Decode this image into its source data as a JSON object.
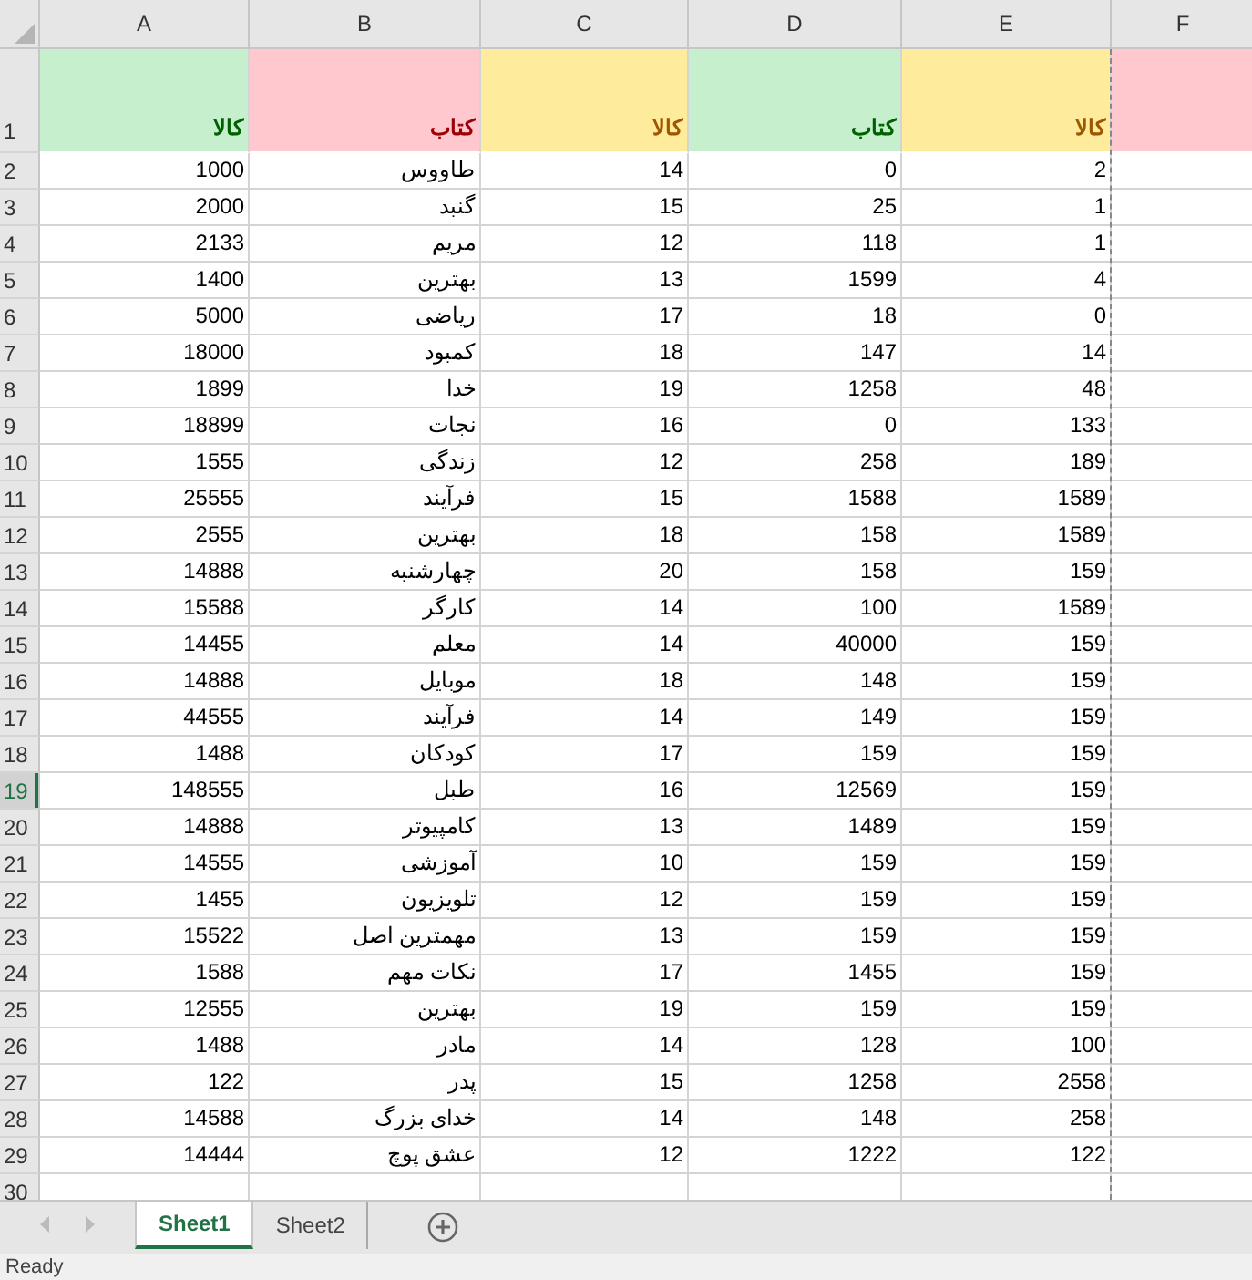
{
  "columns": [
    "F",
    "E",
    "D",
    "C",
    "B",
    "A"
  ],
  "header_row": {
    "row": "1",
    "cells": [
      {
        "kind": "bad"
      },
      {
        "text": "کالا",
        "kind": "neutral"
      },
      {
        "text": "کتاب",
        "kind": "good"
      },
      {
        "text": "کالا",
        "kind": "neutral"
      },
      {
        "text": "کتاب",
        "kind": "bad"
      },
      {
        "text": "کالا",
        "kind": "good"
      }
    ]
  },
  "rows": [
    {
      "row": "2",
      "selected": false,
      "cells": [
        "2",
        "0",
        "14",
        "طاووس",
        "1000"
      ]
    },
    {
      "row": "3",
      "selected": false,
      "cells": [
        "1",
        "25",
        "15",
        "گنبد",
        "2000"
      ]
    },
    {
      "row": "4",
      "selected": false,
      "cells": [
        "1",
        "118",
        "12",
        "مریم",
        "2133"
      ]
    },
    {
      "row": "5",
      "selected": false,
      "cells": [
        "4",
        "1599",
        "13",
        "بهترین",
        "1400"
      ]
    },
    {
      "row": "6",
      "selected": false,
      "cells": [
        "0",
        "18",
        "17",
        "ریاضی",
        "5000"
      ]
    },
    {
      "row": "7",
      "selected": false,
      "cells": [
        "14",
        "147",
        "18",
        "کمبود",
        "18000"
      ]
    },
    {
      "row": "8",
      "selected": false,
      "cells": [
        "48",
        "1258",
        "19",
        "خدا",
        "1899"
      ]
    },
    {
      "row": "9",
      "selected": false,
      "cells": [
        "133",
        "0",
        "16",
        "نجات",
        "18899"
      ]
    },
    {
      "row": "10",
      "selected": false,
      "cells": [
        "189",
        "258",
        "12",
        "زندگی",
        "1555"
      ]
    },
    {
      "row": "11",
      "selected": false,
      "cells": [
        "1589",
        "1588",
        "15",
        "فرآیند",
        "25555"
      ]
    },
    {
      "row": "12",
      "selected": false,
      "cells": [
        "1589",
        "158",
        "18",
        "بهترین",
        "2555"
      ]
    },
    {
      "row": "13",
      "selected": false,
      "cells": [
        "159",
        "158",
        "20",
        "چهارشنبه",
        "14888"
      ]
    },
    {
      "row": "14",
      "selected": false,
      "cells": [
        "1589",
        "100",
        "14",
        "کارگر",
        "15588"
      ]
    },
    {
      "row": "15",
      "selected": false,
      "cells": [
        "159",
        "40000",
        "14",
        "معلم",
        "14455"
      ]
    },
    {
      "row": "16",
      "selected": false,
      "cells": [
        "159",
        "148",
        "18",
        "موبایل",
        "14888"
      ]
    },
    {
      "row": "17",
      "selected": false,
      "cells": [
        "159",
        "149",
        "14",
        "فرآیند",
        "44555"
      ]
    },
    {
      "row": "18",
      "selected": false,
      "cells": [
        "159",
        "159",
        "17",
        "کودکان",
        "1488"
      ]
    },
    {
      "row": "19",
      "selected": true,
      "cells": [
        "159",
        "12569",
        "16",
        "طبل",
        "148555"
      ]
    },
    {
      "row": "20",
      "selected": false,
      "cells": [
        "159",
        "1489",
        "13",
        "کامپیوتر",
        "14888"
      ]
    },
    {
      "row": "21",
      "selected": false,
      "cells": [
        "159",
        "159",
        "10",
        "آموزشی",
        "14555"
      ]
    },
    {
      "row": "22",
      "selected": false,
      "cells": [
        "159",
        "159",
        "12",
        "تلویزیون",
        "1455"
      ]
    },
    {
      "row": "23",
      "selected": false,
      "cells": [
        "159",
        "159",
        "13",
        "مهمترین اصل",
        "15522"
      ]
    },
    {
      "row": "24",
      "selected": false,
      "cells": [
        "159",
        "1455",
        "17",
        "نکات مهم",
        "1588"
      ]
    },
    {
      "row": "25",
      "selected": false,
      "cells": [
        "159",
        "159",
        "19",
        "بهترین",
        "12555"
      ]
    },
    {
      "row": "26",
      "selected": false,
      "cells": [
        "100",
        "128",
        "14",
        "مادر",
        "1488"
      ]
    },
    {
      "row": "27",
      "selected": false,
      "cells": [
        "2558",
        "1258",
        "15",
        "پدر",
        "122"
      ]
    },
    {
      "row": "28",
      "selected": false,
      "cells": [
        "258",
        "148",
        "14",
        "خدای بزرگ",
        "14588"
      ]
    },
    {
      "row": "29",
      "selected": false,
      "cells": [
        "122",
        "1222",
        "12",
        "عشق پوچ",
        "14444"
      ]
    },
    {
      "row": "30",
      "selected": false,
      "cells": []
    }
  ],
  "sheet_tabs": [
    {
      "label": "Sheet2",
      "selected": false
    },
    {
      "label": "Sheet1",
      "selected": true
    }
  ],
  "status_bar": "Ready"
}
